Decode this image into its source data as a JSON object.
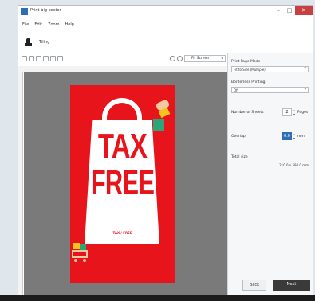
{
  "window": {
    "title": "Print-big poster",
    "controls": [
      "–",
      "□",
      "✕"
    ]
  },
  "menu": [
    "File",
    "Edit",
    "Zoom",
    "Help"
  ],
  "toolbar": {
    "label": "Tiling"
  },
  "zoom": {
    "value": "Fit Screen"
  },
  "poster": {
    "line1": "TAX",
    "line2": "FREE",
    "small": "TAX / FREE"
  },
  "panel": {
    "page_mode_label": "Print Page Mode",
    "page_mode_value": "Fit to Size (Multiple)",
    "borderless_label": "Borderless Printing",
    "borderless_value": "Off",
    "pages_label": "Number of Sheets",
    "pages_value": "2",
    "pages_unit": "Pages",
    "overlap_label": "Overlap",
    "overlap_value": "0.0",
    "overlap_unit": "mm",
    "total_label": "Total size",
    "total_value": "210.0 x 594.0 mm",
    "back_label": "Back",
    "next_label": "Next"
  },
  "colors": {
    "poster_red": "#e8141c",
    "canvas_gray": "#7a7a7a",
    "accent": "#2d6fb3"
  }
}
